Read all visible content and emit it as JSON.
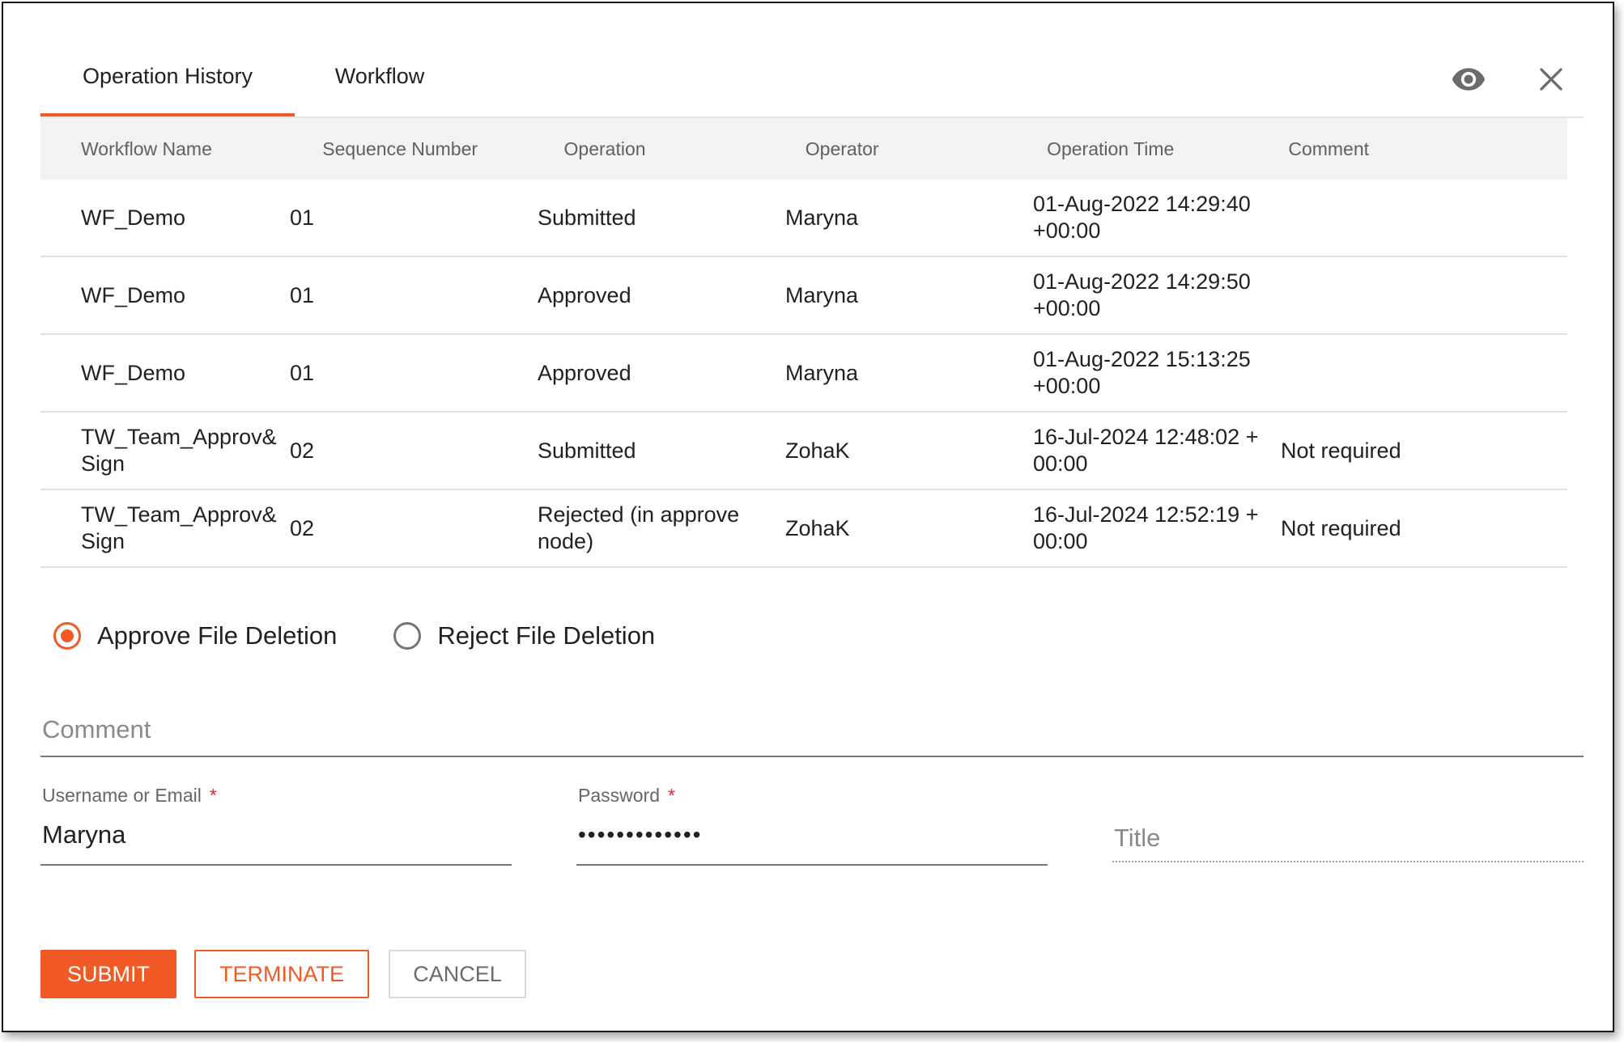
{
  "tabs": [
    {
      "label": "Operation History",
      "active": true
    },
    {
      "label": "Workflow",
      "active": false
    }
  ],
  "icons": {
    "view": "eye-icon",
    "close": "close-icon"
  },
  "table": {
    "columns": [
      "Workflow Name",
      "Sequence Number",
      "Operation",
      "Operator",
      "Operation Time",
      "Comment"
    ],
    "rows": [
      {
        "workflow_name": "WF_Demo",
        "sequence_number": "01",
        "operation": "Submitted",
        "operator": "Maryna",
        "operation_time": "01-Aug-2022 14:29:40 +00:00",
        "comment": ""
      },
      {
        "workflow_name": "WF_Demo",
        "sequence_number": "01",
        "operation": "Approved",
        "operator": "Maryna",
        "operation_time": "01-Aug-2022 14:29:50 +00:00",
        "comment": ""
      },
      {
        "workflow_name": "WF_Demo",
        "sequence_number": "01",
        "operation": "Approved",
        "operator": "Maryna",
        "operation_time": "01-Aug-2022 15:13:25 +00:00",
        "comment": ""
      },
      {
        "workflow_name": "TW_Team_Approv& Sign",
        "sequence_number": "02",
        "operation": "Submitted",
        "operator": "ZohaK",
        "operation_time": "16-Jul-2024 12:48:02 +00:00",
        "comment": "Not required"
      },
      {
        "workflow_name": "TW_Team_Approv& Sign",
        "sequence_number": "02",
        "operation": "Rejected (in approve node)",
        "operator": "ZohaK",
        "operation_time": "16-Jul-2024 12:52:19 +00:00",
        "comment": "Not required"
      }
    ]
  },
  "decision": {
    "approve_label": "Approve File Deletion",
    "reject_label": "Reject File Deletion",
    "selected": "approve"
  },
  "comment": {
    "placeholder": "Comment",
    "value": ""
  },
  "credentials": {
    "username_label": "Username or Email",
    "username_value": "Maryna",
    "password_label": "Password",
    "password_value": "•••••••••••••",
    "required_marker": "*",
    "title_placeholder": "Title"
  },
  "buttons": {
    "submit": "SUBMIT",
    "terminate": "TERMINATE",
    "cancel": "CANCEL"
  },
  "colors": {
    "accent": "#f15a24",
    "required": "#d32f2f"
  }
}
